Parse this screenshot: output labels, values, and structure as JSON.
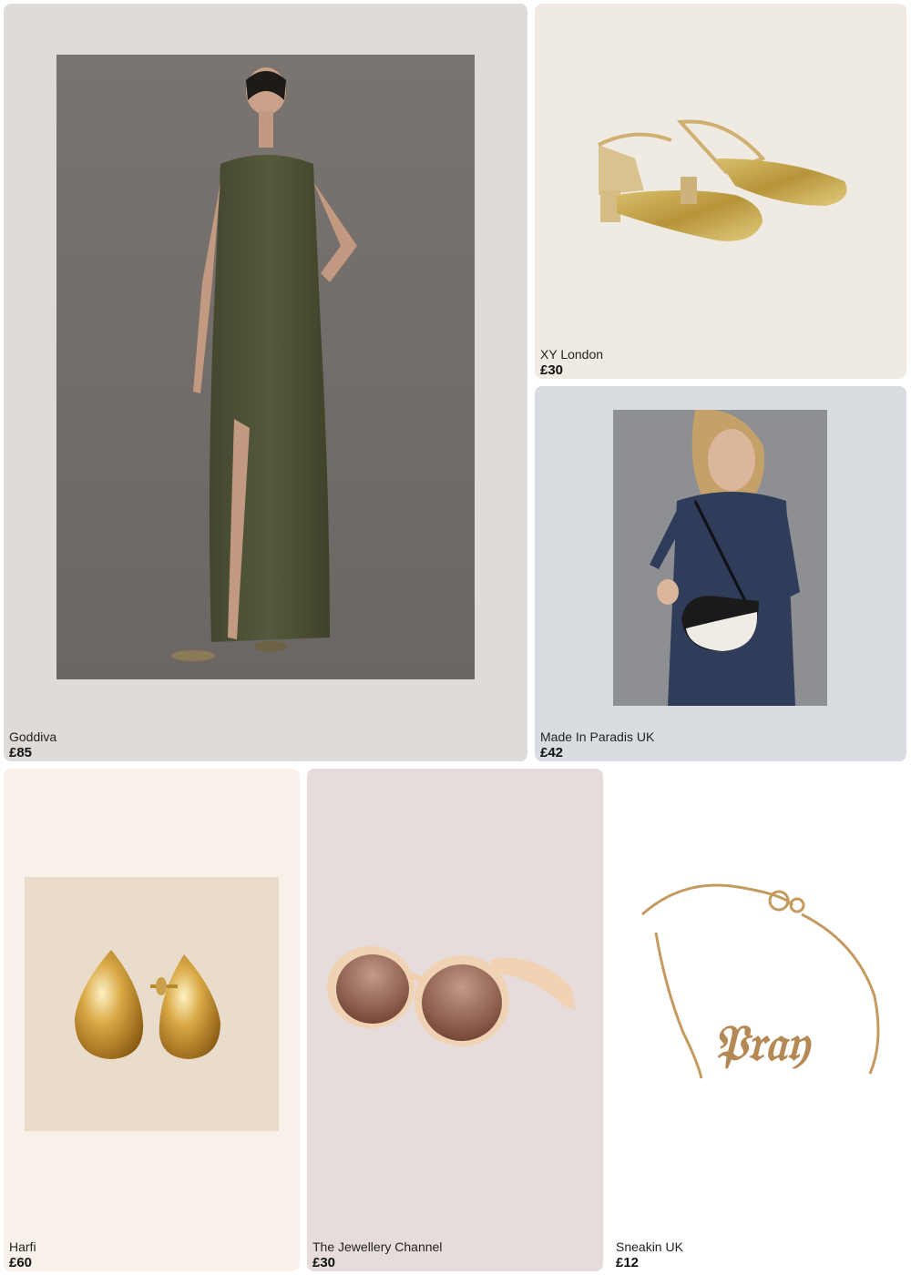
{
  "products": [
    {
      "brand": "Goddiva",
      "price": "£85",
      "image": "olive-maxi-dress-photo",
      "bg": "#dedbd9"
    },
    {
      "brand": "XY London",
      "price": "£30",
      "image": "gold-glitter-slingback-shoes-photo",
      "bg": "#efebe2"
    },
    {
      "brand": "Made In Paradis UK",
      "price": "£42",
      "image": "black-white-crossbody-bag-photo",
      "bg": "#d9dce1"
    },
    {
      "brand": "Harfi",
      "price": "£60",
      "image": "gold-teardrop-earrings-photo",
      "bg": "#f7f1ea"
    },
    {
      "brand": "The Jewellery Channel",
      "price": "£30",
      "image": "peach-frame-sunglasses-photo",
      "bg": "#e5dcdb"
    },
    {
      "brand": "Sneakin UK",
      "price": "£12",
      "image": "gold-pray-nameplate-bracelet-photo",
      "bg": "#ffffff"
    }
  ]
}
